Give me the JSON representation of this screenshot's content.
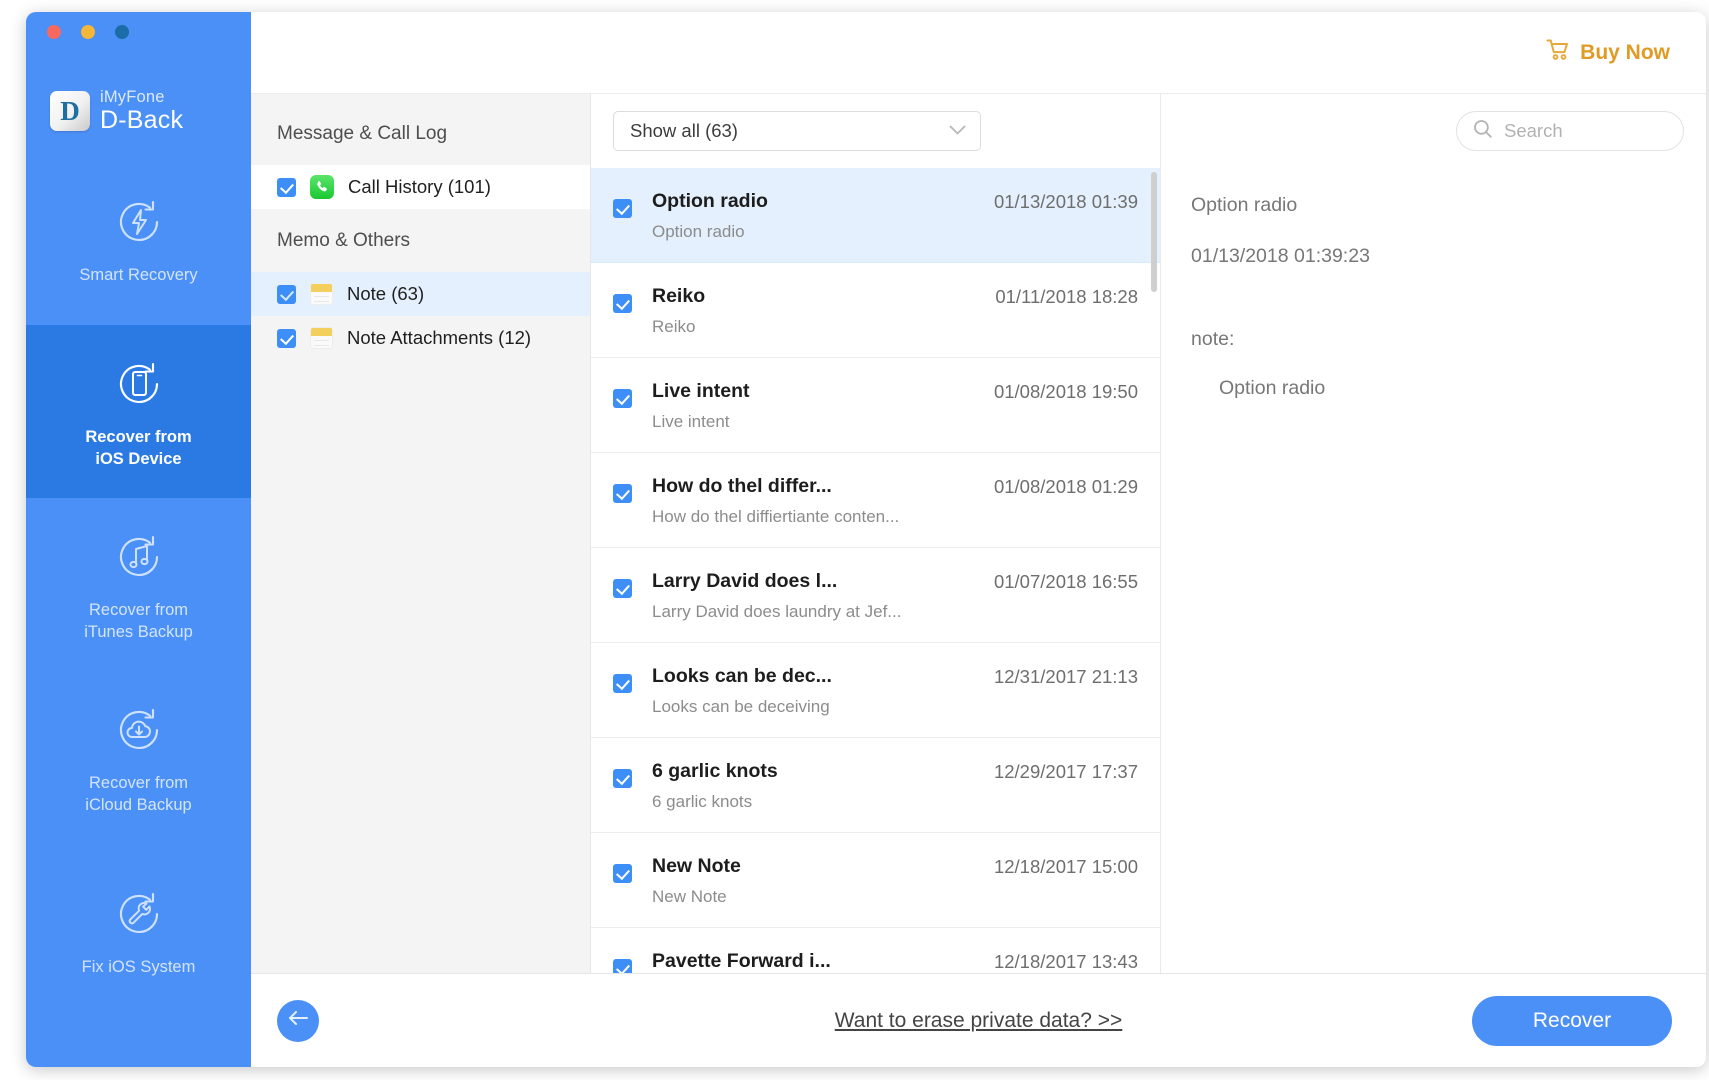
{
  "window": {
    "traffic_lights": [
      "close",
      "minimize",
      "maximize"
    ]
  },
  "brand": {
    "company": "iMyFone",
    "product": "D-Back",
    "logo_letter": "D"
  },
  "sidebar": {
    "items": [
      {
        "label": "Smart Recovery",
        "icon": "bolt-refresh-icon",
        "active": false
      },
      {
        "label": "Recover from\niOS Device",
        "line1": "Recover from",
        "line2": "iOS Device",
        "icon": "phone-refresh-icon",
        "active": true
      },
      {
        "label": "Recover from iTunes Backup",
        "line1": "Recover from",
        "line2": "iTunes Backup",
        "icon": "music-refresh-icon",
        "active": false
      },
      {
        "label": "Recover from iCloud Backup",
        "line1": "Recover from",
        "line2": "iCloud Backup",
        "icon": "cloud-download-refresh-icon",
        "active": false
      },
      {
        "label": "Fix iOS System",
        "line1": "Fix iOS System",
        "line2": "",
        "icon": "wrench-refresh-icon",
        "active": false
      }
    ]
  },
  "topbar": {
    "buy_now_label": "Buy Now",
    "buy_now_color": "#e09b24",
    "cart_icon": "shopping-cart-icon"
  },
  "categories": {
    "groups": [
      {
        "title": "Message & Call Log",
        "items": [
          {
            "label": "Call History (101)",
            "icon": "phone-icon",
            "checked": true,
            "selected": false
          }
        ]
      },
      {
        "title": "Memo & Others",
        "items": [
          {
            "label": "Note (63)",
            "icon": "note-icon",
            "checked": true,
            "selected": true
          },
          {
            "label": "Note Attachments (12)",
            "icon": "note-attachment-icon",
            "checked": true,
            "selected": false
          }
        ]
      }
    ]
  },
  "filter": {
    "selected": "Show all (63)",
    "options": [
      "Show all (63)"
    ],
    "chevron": "chevron-down-icon"
  },
  "search": {
    "placeholder": "Search",
    "value": "",
    "icon": "search-icon"
  },
  "list": {
    "rows": [
      {
        "title": "Option radio",
        "preview": "Option radio",
        "date": "01/13/2018 01:39",
        "checked": true,
        "selected": true
      },
      {
        "title": "Reiko",
        "preview": "Reiko",
        "date": "01/11/2018 18:28",
        "checked": true,
        "selected": false
      },
      {
        "title": "Live intent",
        "preview": "Live intent",
        "date": "01/08/2018 19:50",
        "checked": true,
        "selected": false
      },
      {
        "title": "How do thel differ...",
        "preview": "How do thel diffiertiante conten...",
        "date": "01/08/2018 01:29",
        "checked": true,
        "selected": false
      },
      {
        "title": "Larry David does l...",
        "preview": "Larry David does laundry at Jef...",
        "date": "01/07/2018 16:55",
        "checked": true,
        "selected": false
      },
      {
        "title": "Looks can be dec...",
        "preview": "Looks can be deceiving",
        "date": "12/31/2017 21:13",
        "checked": true,
        "selected": false
      },
      {
        "title": "6 garlic knots",
        "preview": "6 garlic knots",
        "date": "12/29/2017 17:37",
        "checked": true,
        "selected": false
      },
      {
        "title": "New Note",
        "preview": "New Note",
        "date": "12/18/2017 15:00",
        "checked": true,
        "selected": false
      },
      {
        "title": "Pavette Forward i...",
        "preview": "",
        "date": "12/18/2017 13:43",
        "checked": true,
        "selected": false
      }
    ]
  },
  "detail": {
    "title": "Option radio",
    "date": "01/13/2018 01:39:23",
    "note_label": "note:",
    "note_body": "Option radio"
  },
  "footer": {
    "back_icon": "arrow-left-icon",
    "erase_link": "Want to erase private data? >>",
    "recover_label": "Recover",
    "accent_color": "#4b90f7"
  }
}
